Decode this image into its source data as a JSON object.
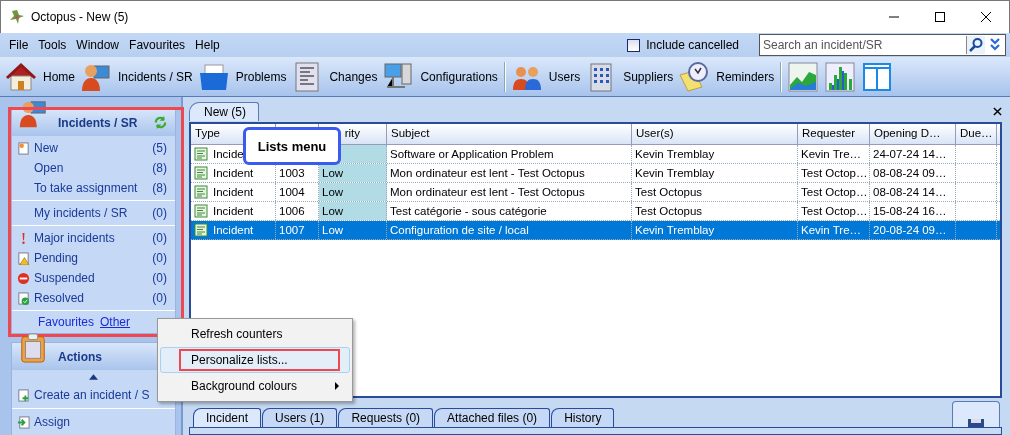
{
  "window": {
    "title": "Octopus - New (5)"
  },
  "menu": [
    "File",
    "Tools",
    "Window",
    "Favourites",
    "Help"
  ],
  "include_cancelled": {
    "label": "Include cancelled",
    "checked": false
  },
  "search": {
    "placeholder": "Search an incident/SR"
  },
  "toolbar": [
    [
      "Home",
      "Incidents / SR",
      "Problems",
      "Changes",
      "Configurations"
    ],
    [
      "Users",
      "Suppliers",
      "Reminders"
    ]
  ],
  "sidebar": {
    "title": "Incidents / SR",
    "annotated": true,
    "groups": [
      [
        {
          "label": "New",
          "count": "(5)"
        },
        {
          "label": "Open",
          "count": "(8)"
        },
        {
          "label": "To take assignment",
          "count": "(8)"
        }
      ],
      [
        {
          "label": "My incidents / SR",
          "count": "(0)"
        }
      ],
      [
        {
          "label": "Major incidents",
          "count": "(0)"
        },
        {
          "label": "Pending",
          "count": "(0)"
        },
        {
          "label": "Suspended",
          "count": "(0)"
        },
        {
          "label": "Resolved",
          "count": "(0)"
        }
      ]
    ],
    "footer": {
      "favourites": "Favourites",
      "other": "Other"
    }
  },
  "actions": {
    "title": "Actions",
    "items": [
      "Create an incident / S",
      "Assign"
    ]
  },
  "tabs": [
    {
      "label": "New (5)",
      "selected": true
    }
  ],
  "table": {
    "columns": [
      "Type",
      null,
      "rity",
      "Subject",
      "User(s)",
      "Requester",
      "Opening D…",
      "Due…"
    ],
    "rows": [
      {
        "selected": false,
        "cells": [
          "Incide",
          null,
          null,
          "Software or Application Problem",
          "Kevin Tremblay",
          "Kevin Tre…",
          "24-07-24 14…"
        ]
      },
      {
        "selected": false,
        "cells": [
          "Incident",
          "1003",
          "Low",
          "Mon ordinateur est lent - Test Octopus",
          "Kevin Tremblay",
          "Test Octop…",
          "08-08-24 09…"
        ]
      },
      {
        "selected": false,
        "cells": [
          "Incident",
          "1004",
          "Low",
          "Mon ordinateur est lent - Test Octopus",
          "Test Octopus",
          "Test Octop…",
          "08-08-24 14…"
        ]
      },
      {
        "selected": false,
        "cells": [
          "Incident",
          "1006",
          "Low",
          "Test catégorie - sous catégorie",
          "Test Octopus",
          "Test Octop…",
          "15-08-24 16…"
        ]
      },
      {
        "selected": true,
        "cells": [
          "Incident",
          "1007",
          "Low",
          "Configuration de site / local",
          "Kevin Tremblay",
          "Kevin Tre…",
          "20-08-24 09…"
        ]
      }
    ]
  },
  "callout": "Lists menu",
  "context_menu": [
    {
      "label": "Refresh counters",
      "selected": false,
      "annotated": false,
      "submenu": false
    },
    {
      "label": "Personalize lists...",
      "selected": true,
      "annotated": true,
      "submenu": false
    },
    {
      "label": "Background colours",
      "selected": false,
      "annotated": false,
      "submenu": true
    }
  ],
  "detail_tabs": [
    {
      "label": "Incident",
      "selected": true
    },
    {
      "label": "Users (1)",
      "selected": false
    },
    {
      "label": "Requests (0)",
      "selected": false
    },
    {
      "label": "Attached files (0)",
      "selected": false
    },
    {
      "label": "History",
      "selected": false
    }
  ]
}
